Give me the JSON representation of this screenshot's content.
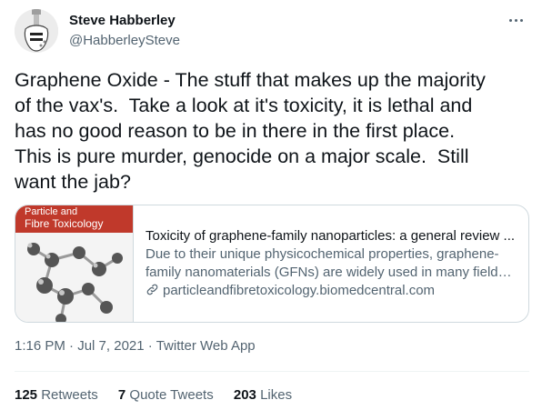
{
  "user": {
    "name": "Steve Habberley",
    "handle": "@HabberleySteve"
  },
  "tweet": {
    "text": "Graphene Oxide - The stuff that makes up the majority\nof the vax's.  Take a look at it's toxicity, it is lethal and\nhas no good reason to be in there in the first place.\nThis is pure murder, genocide on a major scale.  Still\nwant the jab?"
  },
  "card": {
    "thumb_text_line1": "Particle and",
    "thumb_text_line2": "Fibre Toxicology",
    "title": "Toxicity of graphene-family nanoparticles: a general review ...",
    "description_line1": "Due to their unique physicochemical properties, graphene-",
    "description_line2": "family nanomaterials (GFNs) are widely used in many fields, ...",
    "domain": "particleandfibretoxicology.biomedcentral.com"
  },
  "meta": {
    "time": "1:16 PM",
    "date": "Jul 7, 2021",
    "separator": "·",
    "source": "Twitter Web App"
  },
  "stats": {
    "retweets_count": "125",
    "retweets_label": "Retweets",
    "quotes_count": "7",
    "quotes_label": "Quote Tweets",
    "likes_count": "203",
    "likes_label": "Likes"
  },
  "colors": {
    "text_primary": "#0f1419",
    "text_secondary": "#536471",
    "border": "#cfd9de",
    "thumb_banner": "#c0392b"
  },
  "icons": {
    "more": "more-horizontal-icon",
    "link": "link-icon"
  }
}
